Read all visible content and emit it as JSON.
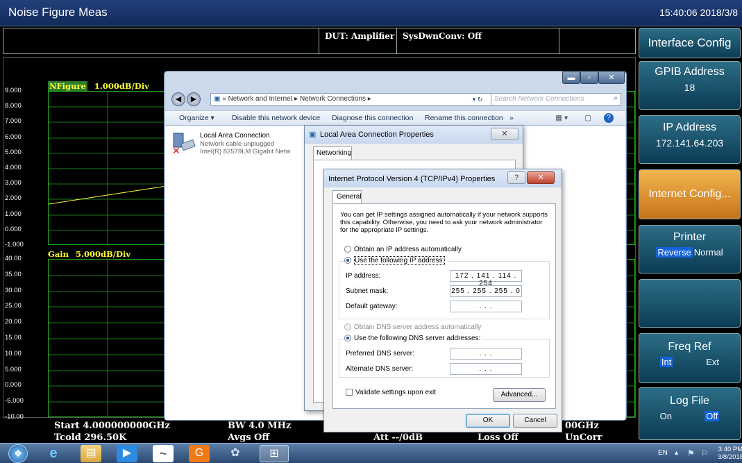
{
  "title_bar": {
    "title": "Noise Figure Meas",
    "clock": "15:40:06  2018/3/8"
  },
  "info_bar": {
    "dut": "DUT:  Amplifier",
    "sysdwnconv": "SysDwnConv:  Off"
  },
  "nfigure_panel": {
    "trace_name": "NFigure",
    "scale": "1.000dB/Div",
    "y_ticks": [
      "9.000",
      "8.000",
      "7.000",
      "6.000",
      "5.000",
      "4.000",
      "3.000",
      "2.000",
      "1.000",
      "0.000",
      "-1.000"
    ]
  },
  "gain_panel": {
    "trace_name": "Gain",
    "scale": "5.000dB/Div",
    "y_ticks": [
      "40.00",
      "35.00",
      "30.00",
      "25.00",
      "20.00",
      "15.00",
      "10.00",
      "5.000",
      "0.000",
      "-5.000",
      "-10.00"
    ]
  },
  "bottom_status": {
    "start": "Start   4.000000000GHz",
    "bw": "BW  4.0  MHz",
    "stop_partial": "00GHz",
    "tcold": "Tcold 296.50K",
    "avgs": "Avgs  Off",
    "att": "Att  --/0dB",
    "loss": "Loss  Off",
    "uncorr": "UnCorr"
  },
  "softkeys": {
    "header": "Interface Config",
    "gpib": {
      "label": "GPIB Address",
      "value": "18"
    },
    "ip": {
      "label": "IP Address",
      "value": "172.141.64.203"
    },
    "internet": {
      "label": "Internet Config..."
    },
    "printer": {
      "label": "Printer",
      "opt1": "Reverse",
      "opt2": "Normal"
    },
    "freqref": {
      "label": "Freq Ref",
      "opt1": "Int",
      "opt2": "Ext"
    },
    "logfile": {
      "label": "Log File",
      "opt1": "On",
      "opt2": "Off"
    }
  },
  "network_window": {
    "breadcrumb": "«  Network and Internet  ▸  Network Connections  ▸",
    "search_placeholder": "Search Network Connections",
    "commands": [
      "Organize ▾",
      "Disable this network device",
      "Diagnose this connection",
      "Rename this connection",
      "»"
    ],
    "connection": {
      "name": "Local Area Connection",
      "status": "Network cable unplugged",
      "adapter": "Intel(R) 82579LM Gigabit Netw"
    }
  },
  "lac_dialog": {
    "title": "Local Area Connection Properties",
    "tab": "Networking"
  },
  "ipv4_dialog": {
    "title": "Internet Protocol Version 4 (TCP/IPv4) Properties",
    "tab": "General",
    "description": "You can get IP settings assigned automatically if your network supports this capability. Otherwise, you need to ask your network administrator for the appropriate IP settings.",
    "auto_ip_label": "Obtain an IP address automatically",
    "manual_ip_label": "Use the following IP address:",
    "ip_label": "IP address:",
    "ip_value": "172 . 141 . 114 . 254",
    "mask_label": "Subnet mask:",
    "mask_value": "255 . 255 . 255 .  0",
    "gateway_label": "Default gateway:",
    "gateway_value": ".     .     .",
    "auto_dns_label": "Obtain DNS server address automatically",
    "manual_dns_label": "Use the following DNS server addresses:",
    "preferred_dns_label": "Preferred DNS server:",
    "preferred_dns_value": ".     .     .",
    "alternate_dns_label": "Alternate DNS server:",
    "alternate_dns_value": ".     .     .",
    "validate_label": "Validate settings upon exit",
    "advanced_label": "Advanced...",
    "ok_label": "OK",
    "cancel_label": "Cancel"
  },
  "taskbar": {
    "lang": "EN",
    "time": "3:40 PM",
    "date": "3/8/2018"
  },
  "colors": {
    "grid_green": "#1fb51f",
    "trace_yellow": "#ffff33",
    "softkey_blue": "#0c3b55",
    "softkey_active": "#e8962e"
  }
}
